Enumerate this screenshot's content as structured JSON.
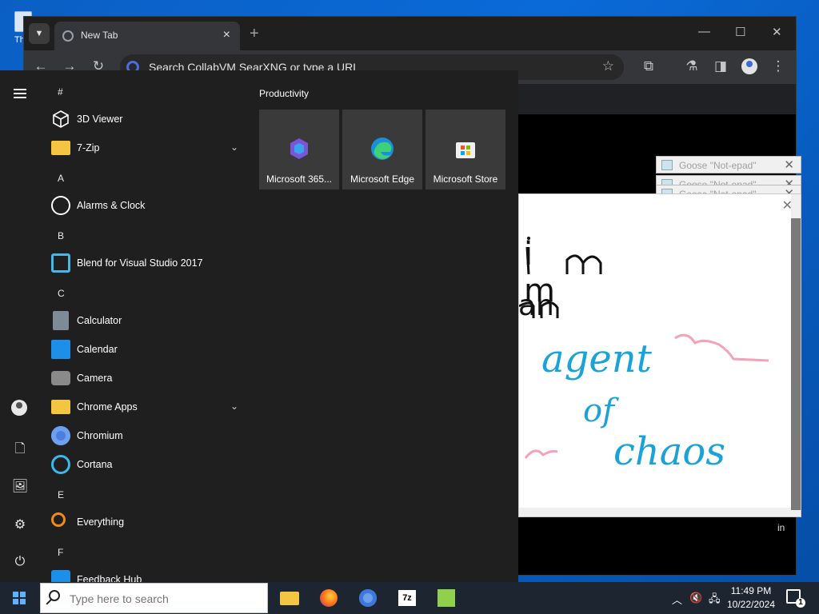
{
  "desktop": {
    "icon_label": "Th"
  },
  "browser": {
    "tab_title": "New Tab",
    "tab_close": "×",
    "new_tab": "+",
    "minimize": "—",
    "maximize": "☐",
    "close": "✕",
    "omnibox_placeholder": "Search CollabVM SearXNG or type a URL",
    "page_edge_text": "in"
  },
  "goose_windows": [
    {
      "title": "Goose \"Not-epad\""
    },
    {
      "title": "Goose \"Not-epad\""
    },
    {
      "title": "Goose \"Not-epad\""
    }
  ],
  "drawing": {
    "words": [
      "i m",
      "an",
      "agent",
      "of",
      "chaos"
    ],
    "ink_colors": {
      "black": "#111111",
      "blue": "#1aa3d9",
      "pink": "#f2a3b8"
    }
  },
  "start_menu": {
    "apps": [
      {
        "type": "letter",
        "text": "#"
      },
      {
        "type": "app",
        "label": "3D Viewer",
        "icon": "cube-icon"
      },
      {
        "type": "app",
        "label": "7-Zip",
        "icon": "folder-icon",
        "expandable": true
      },
      {
        "type": "letter",
        "text": "A"
      },
      {
        "type": "app",
        "label": "Alarms & Clock",
        "icon": "alarm-clock-icon"
      },
      {
        "type": "letter",
        "text": "B"
      },
      {
        "type": "app",
        "label": "Blend for Visual Studio 2017",
        "icon": "blend-icon"
      },
      {
        "type": "letter",
        "text": "C"
      },
      {
        "type": "app",
        "label": "Calculator",
        "icon": "calculator-icon"
      },
      {
        "type": "app",
        "label": "Calendar",
        "icon": "calendar-icon"
      },
      {
        "type": "app",
        "label": "Camera",
        "icon": "camera-icon"
      },
      {
        "type": "app",
        "label": "Chrome Apps",
        "icon": "folder-icon",
        "expandable": true
      },
      {
        "type": "app",
        "label": "Chromium",
        "icon": "chromium-icon"
      },
      {
        "type": "app",
        "label": "Cortana",
        "icon": "cortana-icon"
      },
      {
        "type": "letter",
        "text": "E"
      },
      {
        "type": "app",
        "label": "Everything",
        "icon": "everything-icon"
      },
      {
        "type": "letter",
        "text": "F"
      },
      {
        "type": "app",
        "label": "Feedback Hub",
        "icon": "feedback-icon"
      }
    ],
    "tiles_heading": "Productivity",
    "tiles": [
      {
        "label": "Microsoft 365...",
        "icon": "m365-icon"
      },
      {
        "label": "Microsoft Edge",
        "icon": "edge-icon"
      },
      {
        "label": "Microsoft Store",
        "icon": "store-icon"
      }
    ]
  },
  "taskbar": {
    "search_placeholder": "Type here to search",
    "time": "11:49 PM",
    "date": "10/22/2024",
    "notification_count": "1"
  },
  "colors": {
    "accent_blue": "#0a63c9",
    "start_bg": "#1f1f1f",
    "taskbar_bg": "#1c2530"
  }
}
